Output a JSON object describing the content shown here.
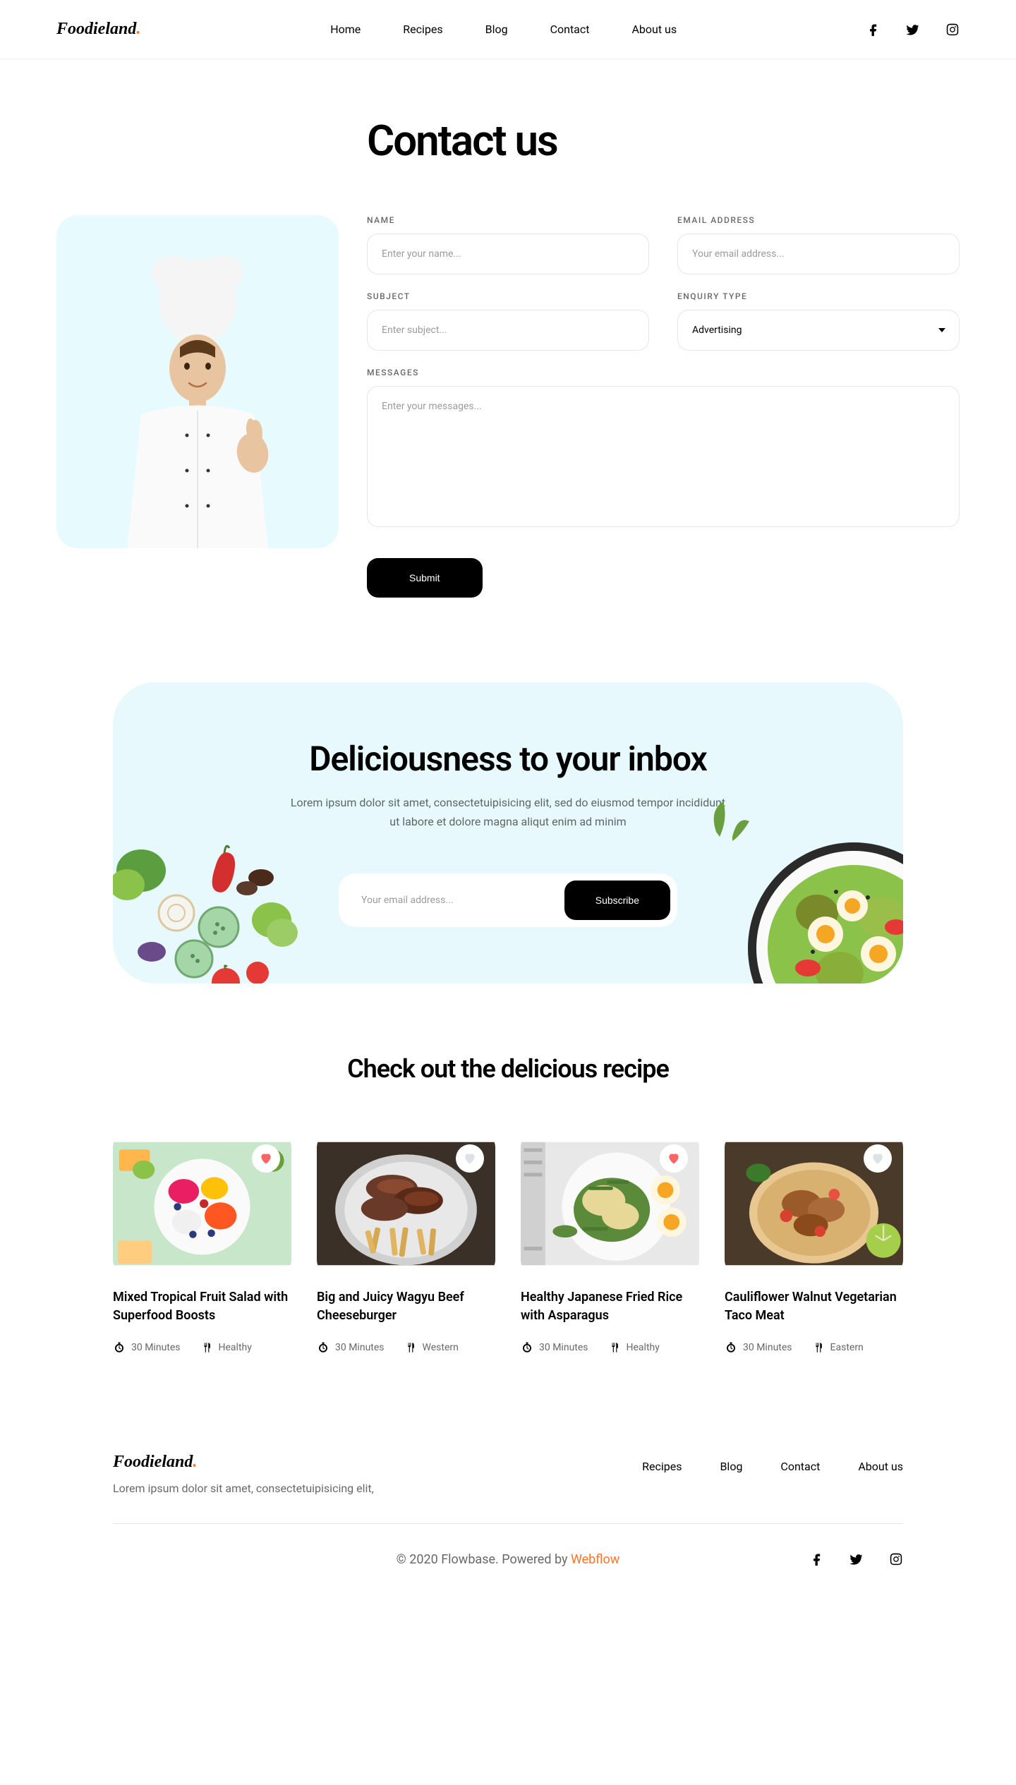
{
  "brand": "Foodieland",
  "nav": {
    "items": [
      "Home",
      "Recipes",
      "Blog",
      "Contact",
      "About us"
    ]
  },
  "contact": {
    "title": "Contact us",
    "fields": {
      "name_label": "NAME",
      "name_placeholder": "Enter your name...",
      "email_label": "EMAIL ADDRESS",
      "email_placeholder": "Your email address...",
      "subject_label": "SUBJECT",
      "subject_placeholder": "Enter subject...",
      "enquiry_label": "ENQUIRY TYPE",
      "enquiry_value": "Advertising",
      "messages_label": "MESSAGES",
      "messages_placeholder": "Enter your messages..."
    },
    "submit": "Submit"
  },
  "subscribe": {
    "title": "Deliciousness to your inbox",
    "desc": "Lorem ipsum dolor sit amet, consectetuipisicing elit, sed do eiusmod tempor incididunt ut labore et dolore magna aliqut enim ad minim",
    "placeholder": "Your email address...",
    "button": "Subscribe"
  },
  "recipes": {
    "title": "Check out the delicious recipe",
    "items": [
      {
        "name": "Mixed Tropical Fruit Salad with Superfood Boosts",
        "time": "30 Minutes",
        "category": "Healthy",
        "fav": true
      },
      {
        "name": "Big and Juicy Wagyu Beef Cheeseburger",
        "time": "30 Minutes",
        "category": "Western",
        "fav": false
      },
      {
        "name": "Healthy Japanese Fried Rice with Asparagus",
        "time": "30 Minutes",
        "category": "Healthy",
        "fav": true
      },
      {
        "name": "Cauliflower Walnut Vegetarian Taco Meat",
        "time": "30 Minutes",
        "category": "Eastern",
        "fav": false
      }
    ]
  },
  "footer": {
    "desc": "Lorem ipsum dolor sit amet, consectetuipisicing elit,",
    "nav": [
      "Recipes",
      "Blog",
      "Contact",
      "About us"
    ],
    "copyright_prefix": "© 2020 Flowbase. Powered by ",
    "copyright_brand": "Webflow"
  }
}
